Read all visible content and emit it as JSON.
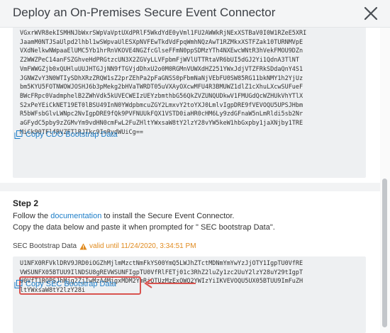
{
  "dialog": {
    "title": "Deploy an On-Premises Secure Event Connector"
  },
  "cdo": {
    "bootstrap_lines": [
      "VGxrWVR8ekISMHNJbWxrSWpVaVptUXdPRlF5WkdYdE0yVml1FU2AWWkRjNExXSTBaV0I0W1RZeE5XRI",
      "JaamM0NTJSaUlpd2lhbl1wSWpvaUlESXpNVFEwTkdVdFpqWmhNQzAwT1RZMkxXSTFZak10TURNMVpE",
      "VXdNelkwNWpaaElUMC5Yb1hrRnVKOVE4NGZfcGlseFFmN0ppSDMzYTh4NXEwcWNtR3hVekFMOU9DZn",
      "Z2WWZPeC14anFSZGhveHdPRGtzcUN3X2ZGVyLLVFpbmFjWVlUTTRtaVR6bUI5dGJ2Yi1QdnA3TlNT",
      "VmFWWGZjb0xQUHluUUJHTGJjNN9fTGVjdDhxU2o0M0RGMnVUWXdHZ251YWxJdjVTZFRkSDdaQnY4S1",
      "JGNWZvY3N0WTIySDhXRzZRQW1sZ2prZEhPa2pFaGNSS0pFbmNaNjVEbFU0SW85RG11bkNMY1h2YjUz",
      "bm5KYU5FOTNWOWJOSHJ6b3pMekg2bHVaTWRDT05uVXAyOXcwMFU4R3BMUWZ1dlZ1cXhuLXcwSUFueF",
      "BWcFRpc0VadmphelB2ZWhVdk5kUVECWEIzUEYzbmthbG56QkZVZUNQUDkwV1FMUGdQcWZHUkVhYTlX",
      "S2xPeYEiCkNET19ET0lBSU49InN0YWdpbmcuZGY2LmxvY2toYXJ0LmlvIgpDRE9fVEVOQU5UPSJHbm",
      "R5bWFsbGlvLWNpc2NvIgpDRE9fQk9PVFNUUkFQX1VSTD0iaHR0cHM6Ly9zdGFnaW5nLmRldi5sb2Nr",
      "aGFydC5pby9zZGMvYm9vdHN0cmFwL2FuZHltYWxsaW8tY2lzY28vYW5keW1hbGxpby1jaXNjby1TRE",
      "MiCk90TFlfRVZFTlRJTkc9InRydWUiCg=="
    ],
    "copy_label": "Copy CDO Bootstrap Data"
  },
  "step2": {
    "title": "Step 2",
    "line1_prefix": "Follow the ",
    "line1_link": "documentation",
    "line1_suffix": " to install the Secure Event Connector.",
    "line2": "Copy the data below and paste it when prompted for \" SEC bootstrap Data\"."
  },
  "sec": {
    "label": "SEC Bootstrap Data",
    "validity": "valid until 11/24/2020, 3:34:51 PM",
    "bootstrap_lines": [
      "U1NFX0RFVklDRV9JRD0iOGZhMjlmMzctNmFkYS00YmQ5LWJhZTctMDNmYmYwYzJjOTY1IgpTU0VfRE",
      "VWSUNFX05BTUU9IlNDSU8gREVWSUNFIgpTU0VfRlFETj01c3RhZ2luZy1zc2UuY2lzY28uY29tIgpT",
      "U0VfT1RQPSJhMjg2ZjIwMzA4MjgxMDM2YmRjOTUzMzExOWQ2YWIzYiIKVEVOQU5UX05BTUU9ImFuZH",
      "ltYWxsaW8tY2lzY28i"
    ],
    "copy_label": "Copy SEC Bootstrap Data"
  },
  "colors": {
    "link": "#1e7ec8",
    "warning": "#e08a1e",
    "highlight": "#d9534f"
  }
}
